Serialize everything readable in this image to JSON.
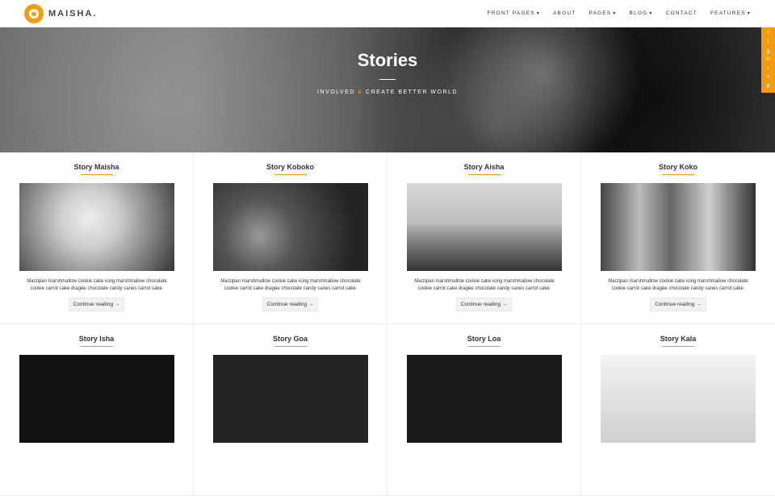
{
  "header": {
    "brand": "MAISHA.",
    "nav": [
      {
        "label": "FRONT PAGES",
        "has_caret": true
      },
      {
        "label": "ABOUT",
        "has_caret": false
      },
      {
        "label": "PAGES",
        "has_caret": true
      },
      {
        "label": "BLOG",
        "has_caret": true
      },
      {
        "label": "CONTACT",
        "has_caret": false
      },
      {
        "label": "FEATURES",
        "has_caret": true
      }
    ]
  },
  "hero": {
    "title": "Stories",
    "subtitle_part1": "INVOLVED",
    "subtitle_amp": "&",
    "subtitle_part2": "CREATE BETTER WORLD"
  },
  "social": [
    {
      "icon": "facebook-icon",
      "glyph": "f"
    },
    {
      "icon": "twitter-icon",
      "glyph": "t"
    },
    {
      "icon": "google-plus-icon",
      "glyph": "g"
    },
    {
      "icon": "linkedin-icon",
      "glyph": "in"
    },
    {
      "icon": "rss-icon",
      "glyph": "r"
    },
    {
      "icon": "vimeo-icon",
      "glyph": "v"
    },
    {
      "icon": "pinterest-icon",
      "glyph": "p"
    }
  ],
  "cards": [
    {
      "title": "Story Maisha",
      "text": "Marzipan marshmallow cookie cake icing marshmallow chocolate cookie carrot cake dragée chocolate candy canes carrot cake.",
      "button": "Continue reading →"
    },
    {
      "title": "Story Koboko",
      "text": "Marzipan marshmallow cookie cake icing marshmallow chocolate cookie carrot cake dragée chocolate candy canes carrot cake.",
      "button": "Continue reading →"
    },
    {
      "title": "Story Aisha",
      "text": "Marzipan marshmallow cookie cake icing marshmallow chocolate cookie carrot cake dragée chocolate candy canes carrot cake.",
      "button": "Continue reading →"
    },
    {
      "title": "Story Koko",
      "text": "Marzipan marshmallow cookie cake icing marshmallow chocolate cookie carrot cake dragée chocolate candy canes carrot cake.",
      "button": "Continue reading →"
    },
    {
      "title": "Story Isha",
      "text": "",
      "button": ""
    },
    {
      "title": "Story Goa",
      "text": "",
      "button": ""
    },
    {
      "title": "Story Loa",
      "text": "",
      "button": ""
    },
    {
      "title": "Story Kala",
      "text": "",
      "button": ""
    }
  ],
  "colors": {
    "accent": "#f39c12"
  }
}
